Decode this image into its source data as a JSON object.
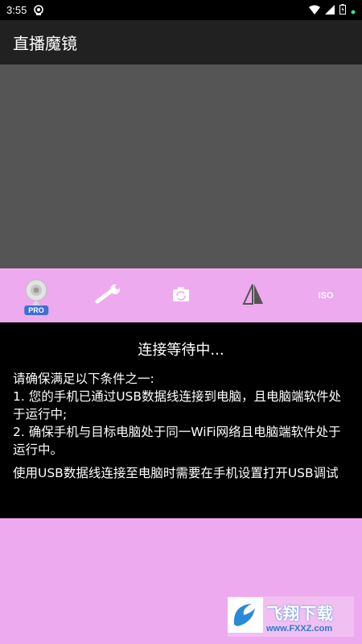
{
  "status_bar": {
    "time": "3:55",
    "icons": [
      "notification-icon",
      "wifi-icon",
      "signal-icon",
      "battery-icon",
      "dot-icon"
    ]
  },
  "app_bar": {
    "title": "直播魔镜"
  },
  "toolbar": {
    "items": [
      {
        "icon": "webcam-icon",
        "badge": "PRO"
      },
      {
        "icon": "wrench-icon"
      },
      {
        "icon": "camera-switch-icon"
      },
      {
        "icon": "mirror-flip-icon"
      },
      {
        "icon": "iso-icon",
        "label": "ISO"
      }
    ]
  },
  "panel": {
    "heading": "连接等待中...",
    "lines": [
      "请确保满足以下条件之一:",
      "1. 您的手机已通过USB数据线连接到电脑，且电脑端软件处于运行中;",
      "2. 确保手机与目标电脑处于同一WiFi网络且电脑端软件处于运行中。",
      "使用USB数据线连接至电脑时需要在手机设置打开USB调试"
    ]
  },
  "watermark": {
    "brand": "飞翔下载",
    "url": "www.FXXZ.com"
  },
  "colors": {
    "accent": "#eeaaee",
    "app_bar": "#212121",
    "preview": "#555555",
    "pro_badge": "#3e6fd1"
  }
}
